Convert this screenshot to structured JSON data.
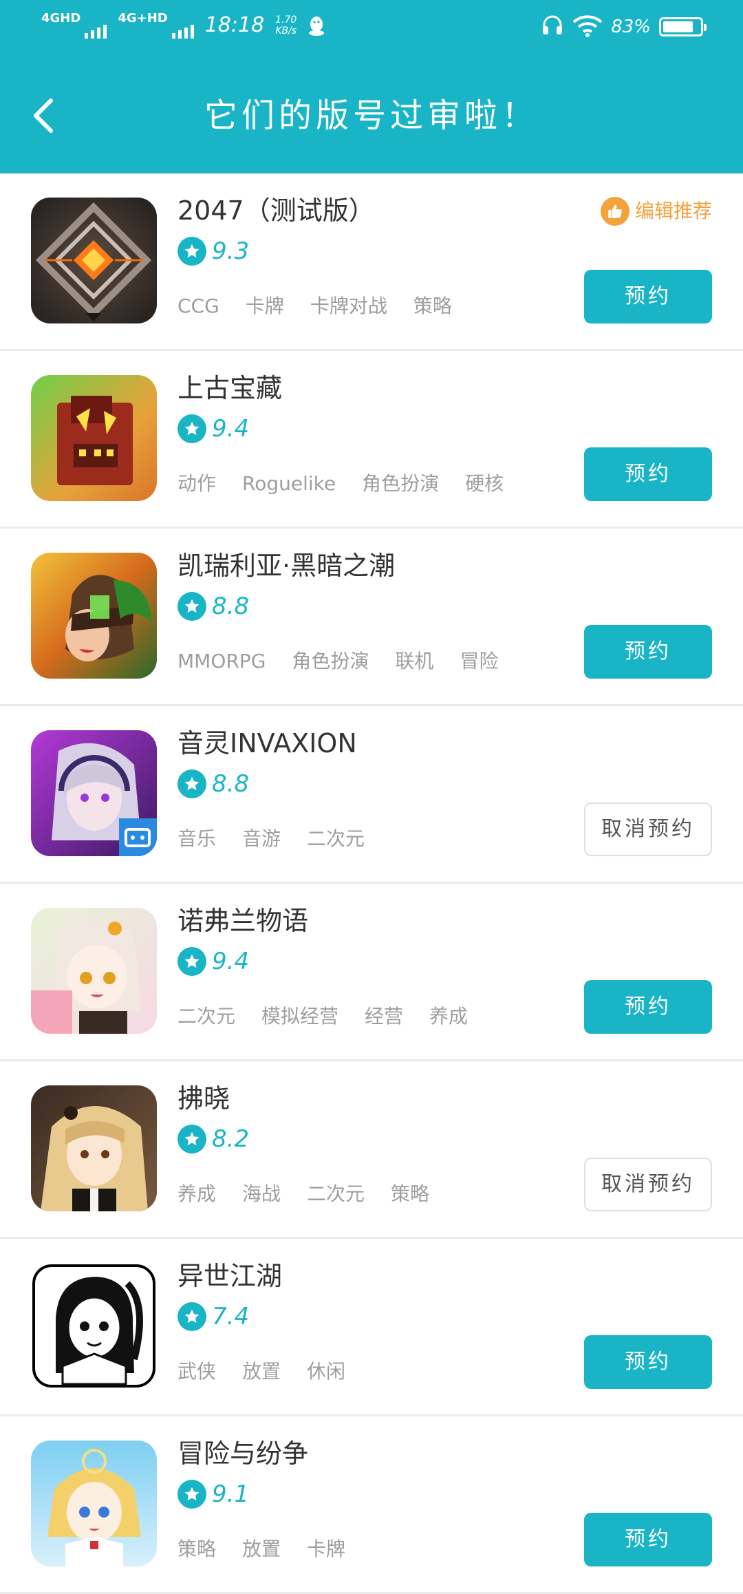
{
  "status_bar": {
    "signal_1": "4GHD",
    "signal_2": "4G+HD",
    "time": "18:18",
    "speed_value": "1.70",
    "speed_unit": "KB/s",
    "battery_pct": "83%",
    "battery_level": 0.83
  },
  "header": {
    "title": "它们的版号过审啦！",
    "back_icon": "back-arrow-icon"
  },
  "colors": {
    "accent": "#19B5C6",
    "editor_pick": "#F3A23C"
  },
  "games": [
    {
      "name": "2047（测试版）",
      "rating": "9.3",
      "tags": [
        "CCG",
        "卡牌",
        "卡牌对战",
        "策略"
      ],
      "button": "预约",
      "button_style": "primary",
      "badge": "编辑推荐",
      "icon": "game-2047-icon"
    },
    {
      "name": "上古宝藏",
      "rating": "9.4",
      "tags": [
        "动作",
        "Roguelike",
        "角色扮演",
        "硬核"
      ],
      "button": "预约",
      "button_style": "primary",
      "icon": "game-ancient-treasure-icon"
    },
    {
      "name": "凯瑞利亚·黑暗之潮",
      "rating": "8.8",
      "tags": [
        "MMORPG",
        "角色扮演",
        "联机",
        "冒险"
      ],
      "button": "预约",
      "button_style": "primary",
      "icon": "game-kerelia-icon"
    },
    {
      "name": "音灵INVAXION",
      "rating": "8.8",
      "tags": [
        "音乐",
        "音游",
        "二次元"
      ],
      "button": "取消预约",
      "button_style": "cancel",
      "icon": "game-invaxion-icon"
    },
    {
      "name": "诺弗兰物语",
      "rating": "9.4",
      "tags": [
        "二次元",
        "模拟经营",
        "经营",
        "养成"
      ],
      "button": "预约",
      "button_style": "primary",
      "icon": "game-norfland-icon"
    },
    {
      "name": "拂晓",
      "rating": "8.2",
      "tags": [
        "养成",
        "海战",
        "二次元",
        "策略"
      ],
      "button": "取消预约",
      "button_style": "cancel",
      "icon": "game-dawn-icon"
    },
    {
      "name": "异世江湖",
      "rating": "7.4",
      "tags": [
        "武侠",
        "放置",
        "休闲"
      ],
      "button": "预约",
      "button_style": "primary",
      "icon": "game-otherworld-icon"
    },
    {
      "name": "冒险与纷争",
      "rating": "9.1",
      "tags": [
        "策略",
        "放置",
        "卡牌"
      ],
      "button": "预约",
      "button_style": "primary",
      "icon": "game-adventure-icon"
    }
  ]
}
